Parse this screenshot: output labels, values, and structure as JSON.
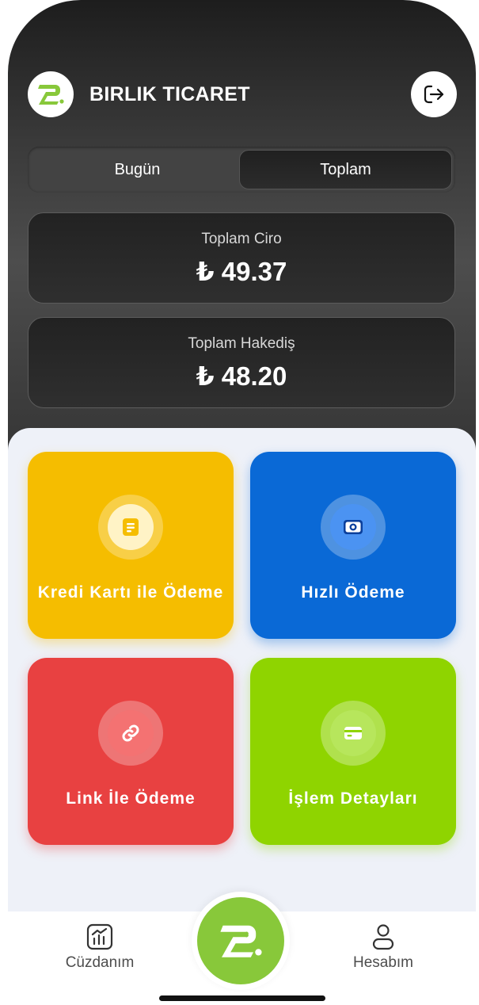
{
  "header": {
    "company_name": "BIRLIK TICARET",
    "logout_icon": "logout-arrow-icon",
    "logo_icon": "app-logo-icon"
  },
  "period_tabs": {
    "items": [
      "Bugün",
      "Toplam"
    ],
    "selected": "Toplam"
  },
  "summary": {
    "total_revenue_label": "Toplam Ciro",
    "total_revenue_value": "₺ 49.37",
    "total_earnings_label": "Toplam Hakediş",
    "total_earnings_value": "₺ 48.20"
  },
  "actions": [
    {
      "label": "Kredi Kartı ile Ödeme",
      "icon": "document-icon",
      "color": "#f5bd00"
    },
    {
      "label": "Hızlı Ödeme",
      "icon": "camera-icon",
      "color": "#0a69d6"
    },
    {
      "label": "Link İle Ödeme",
      "icon": "link-icon",
      "color": "#e84141"
    },
    {
      "label": "İşlem Detayları",
      "icon": "card-icon",
      "color": "#8fd400"
    }
  ],
  "bottom_nav": {
    "wallet_label": "Cüzdanım",
    "account_label": "Hesabım",
    "center_icon": "app-logo-icon"
  }
}
